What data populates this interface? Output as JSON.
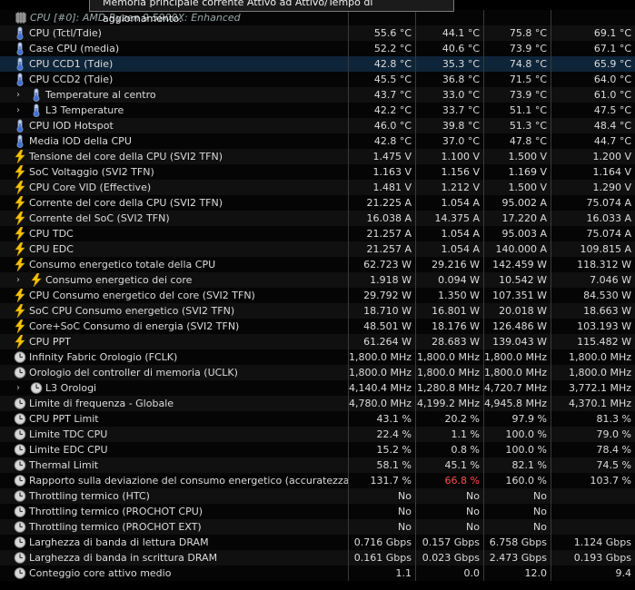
{
  "tooltip": "Memoria principale corrente Attivo ad Attivo/Tempo di aggiornamento.",
  "group_header": "CPU [#0]: AMD Ryzen 9 5900X: Enhanced",
  "colors": {
    "red_value": "#ff4d4d",
    "selected_row": "#0e2438",
    "tooltip_bg": "#1b1b1b"
  },
  "rows": [
    {
      "name": "CPU (Tctl/Tdie)",
      "icon": "thermometer-icon",
      "v": [
        "55.6 °C",
        "44.1 °C",
        "75.8 °C",
        "69.1 °C"
      ]
    },
    {
      "name": "Case CPU (media)",
      "icon": "thermometer-icon",
      "v": [
        "52.2 °C",
        "40.6 °C",
        "73.9 °C",
        "67.1 °C"
      ]
    },
    {
      "name": "CPU CCD1 (Tdie)",
      "icon": "thermometer-icon",
      "v": [
        "42.8 °C",
        "35.3 °C",
        "74.8 °C",
        "65.9 °C"
      ],
      "selected": true
    },
    {
      "name": "CPU CCD2 (Tdie)",
      "icon": "thermometer-icon",
      "v": [
        "45.5 °C",
        "36.8 °C",
        "71.5 °C",
        "64.0 °C"
      ]
    },
    {
      "name": "Temperature al centro",
      "icon": "thermometer-icon",
      "v": [
        "43.7 °C",
        "33.0 °C",
        "73.9 °C",
        "61.0 °C"
      ],
      "expand": true
    },
    {
      "name": "L3 Temperature",
      "icon": "thermometer-icon",
      "v": [
        "42.2 °C",
        "33.7 °C",
        "51.1 °C",
        "47.5 °C"
      ],
      "expand": true
    },
    {
      "name": "CPU IOD Hotspot",
      "icon": "thermometer-icon",
      "v": [
        "46.0 °C",
        "39.8 °C",
        "51.3 °C",
        "48.4 °C"
      ]
    },
    {
      "name": "Media IOD della CPU",
      "icon": "thermometer-icon",
      "v": [
        "42.8 °C",
        "37.0 °C",
        "47.8 °C",
        "44.7 °C"
      ]
    },
    {
      "name": "Tensione del core della CPU (SVI2 TFN)",
      "icon": "bolt-icon",
      "v": [
        "1.475 V",
        "1.100 V",
        "1.500 V",
        "1.200 V"
      ]
    },
    {
      "name": "SoC Voltaggio (SVI2 TFN)",
      "icon": "bolt-icon",
      "v": [
        "1.163 V",
        "1.156 V",
        "1.169 V",
        "1.164 V"
      ]
    },
    {
      "name": "CPU Core VID (Effective)",
      "icon": "bolt-icon",
      "v": [
        "1.481 V",
        "1.212 V",
        "1.500 V",
        "1.290 V"
      ]
    },
    {
      "name": "Corrente del core della CPU (SVI2 TFN)",
      "icon": "bolt-icon",
      "v": [
        "21.225 A",
        "1.054 A",
        "95.002 A",
        "75.074 A"
      ]
    },
    {
      "name": "Corrente del SoC (SVI2 TFN)",
      "icon": "bolt-icon",
      "v": [
        "16.038 A",
        "14.375 A",
        "17.220 A",
        "16.033 A"
      ]
    },
    {
      "name": "CPU TDC",
      "icon": "bolt-icon",
      "v": [
        "21.257 A",
        "1.054 A",
        "95.003 A",
        "75.074 A"
      ]
    },
    {
      "name": "CPU EDC",
      "icon": "bolt-icon",
      "v": [
        "21.257 A",
        "1.054 A",
        "140.000 A",
        "109.815 A"
      ]
    },
    {
      "name": "Consumo energetico totale della CPU",
      "icon": "bolt-icon",
      "v": [
        "62.723 W",
        "29.216 W",
        "142.459 W",
        "118.312 W"
      ]
    },
    {
      "name": "Consumo energetico dei core",
      "icon": "bolt-icon",
      "v": [
        "1.918 W",
        "0.094 W",
        "10.542 W",
        "7.046 W"
      ],
      "expand": true
    },
    {
      "name": "CPU Consumo energetico del core (SVI2 TFN)",
      "icon": "bolt-icon",
      "v": [
        "29.792 W",
        "1.350 W",
        "107.351 W",
        "84.530 W"
      ]
    },
    {
      "name": "SoC CPU Consumo energetico (SVI2 TFN)",
      "icon": "bolt-icon",
      "v": [
        "18.710 W",
        "16.801 W",
        "20.018 W",
        "18.663 W"
      ]
    },
    {
      "name": "Core+SoC Consumo di energia (SVI2 TFN)",
      "icon": "bolt-icon",
      "v": [
        "48.501 W",
        "18.176 W",
        "126.486 W",
        "103.193 W"
      ]
    },
    {
      "name": "CPU PPT",
      "icon": "bolt-icon",
      "v": [
        "61.264 W",
        "28.683 W",
        "139.043 W",
        "115.482 W"
      ]
    },
    {
      "name": "Infinity Fabric Orologio (FCLK)",
      "icon": "clock-icon",
      "v": [
        "1,800.0 MHz",
        "1,800.0 MHz",
        "1,800.0 MHz",
        "1,800.0 MHz"
      ]
    },
    {
      "name": "Orologio del controller di memoria (UCLK)",
      "icon": "clock-icon",
      "v": [
        "1,800.0 MHz",
        "1,800.0 MHz",
        "1,800.0 MHz",
        "1,800.0 MHz"
      ]
    },
    {
      "name": "L3 Orologi",
      "icon": "clock-icon",
      "v": [
        "4,140.4 MHz",
        "1,280.8 MHz",
        "4,720.7 MHz",
        "3,772.1 MHz"
      ],
      "expand": true
    },
    {
      "name": "Limite di frequenza - Globale",
      "icon": "clock-icon",
      "v": [
        "4,780.0 MHz",
        "4,199.2 MHz",
        "4,945.8 MHz",
        "4,370.1 MHz"
      ]
    },
    {
      "name": "CPU PPT Limit",
      "icon": "clock-icon",
      "v": [
        "43.1 %",
        "20.2 %",
        "97.9 %",
        "81.3 %"
      ]
    },
    {
      "name": "Limite TDC CPU",
      "icon": "clock-icon",
      "v": [
        "22.4 %",
        "1.1 %",
        "100.0 %",
        "79.0 %"
      ]
    },
    {
      "name": "Limite EDC CPU",
      "icon": "clock-icon",
      "v": [
        "15.2 %",
        "0.8 %",
        "100.0 %",
        "78.4 %"
      ]
    },
    {
      "name": "Thermal Limit",
      "icon": "clock-icon",
      "v": [
        "58.1 %",
        "45.1 %",
        "82.1 %",
        "74.5 %"
      ]
    },
    {
      "name": "Rapporto sulla deviazione del consumo energetico (accuratezza)",
      "icon": "clock-icon",
      "v": [
        "131.7 %",
        "66.8 %",
        "160.0 %",
        "103.7 %"
      ],
      "red": [
        1
      ]
    },
    {
      "name": "Throttling termico (HTC)",
      "icon": "clock-icon",
      "v": [
        "No",
        "No",
        "No",
        ""
      ]
    },
    {
      "name": "Throttling termico (PROCHOT CPU)",
      "icon": "clock-icon",
      "v": [
        "No",
        "No",
        "No",
        ""
      ]
    },
    {
      "name": "Throttling termico (PROCHOT EXT)",
      "icon": "clock-icon",
      "v": [
        "No",
        "No",
        "No",
        ""
      ]
    },
    {
      "name": "Larghezza di banda di lettura DRAM",
      "icon": "clock-icon",
      "v": [
        "0.716 Gbps",
        "0.157 Gbps",
        "6.758 Gbps",
        "1.124 Gbps"
      ]
    },
    {
      "name": "Larghezza di banda in scrittura DRAM",
      "icon": "clock-icon",
      "v": [
        "0.161 Gbps",
        "0.023 Gbps",
        "2.473 Gbps",
        "0.193 Gbps"
      ]
    },
    {
      "name": "Conteggio core attivo medio",
      "icon": "clock-icon",
      "v": [
        "1.1",
        "0.0",
        "12.0",
        "9.4"
      ]
    }
  ]
}
